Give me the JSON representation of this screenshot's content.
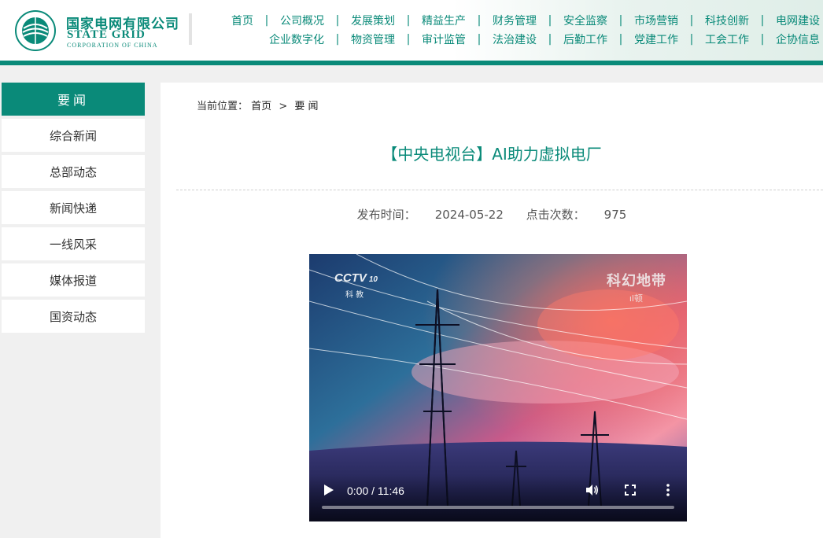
{
  "header": {
    "logo_cn": "国家电网有限公司",
    "logo_en": "STATE GRID",
    "logo_en_sub": "CORPORATION OF CHINA",
    "nav_row1": [
      "首页",
      "公司概况",
      "发展策划",
      "精益生产",
      "财务管理",
      "安全监察",
      "市场营销",
      "科技创新",
      "电网建设"
    ],
    "nav_row2": [
      "企业数字化",
      "物资管理",
      "审计监管",
      "法治建设",
      "后勤工作",
      "党建工作",
      "工会工作",
      "企协信息"
    ],
    "nav_separator": "|"
  },
  "sidebar": {
    "title": "要闻",
    "items": [
      "综合新闻",
      "总部动态",
      "新闻快递",
      "一线风采",
      "媒体报道",
      "国资动态"
    ]
  },
  "breadcrumb": {
    "label": "当前位置：",
    "home": "首页",
    "separator": ">",
    "current": "要 闻"
  },
  "article": {
    "title": "【中央电视台】AI助力虚拟电厂",
    "publish_label": "发布时间：",
    "publish_date": "2024-05-22",
    "clicks_label": "点击次数：",
    "clicks": "975"
  },
  "video": {
    "channel_logo": "CCTV",
    "channel_number": "10",
    "channel_sub": "科 教",
    "program_name": "科幻地带",
    "program_sub": "ıl顿",
    "current_time": "0:00",
    "time_separator": " / ",
    "duration": "11:46",
    "progress": 0,
    "icons": [
      "play-icon",
      "volume-icon",
      "fullscreen-icon",
      "more-options-icon"
    ]
  },
  "colors": {
    "brand": "#0a8a79",
    "page_bg": "#f0f0f0"
  }
}
